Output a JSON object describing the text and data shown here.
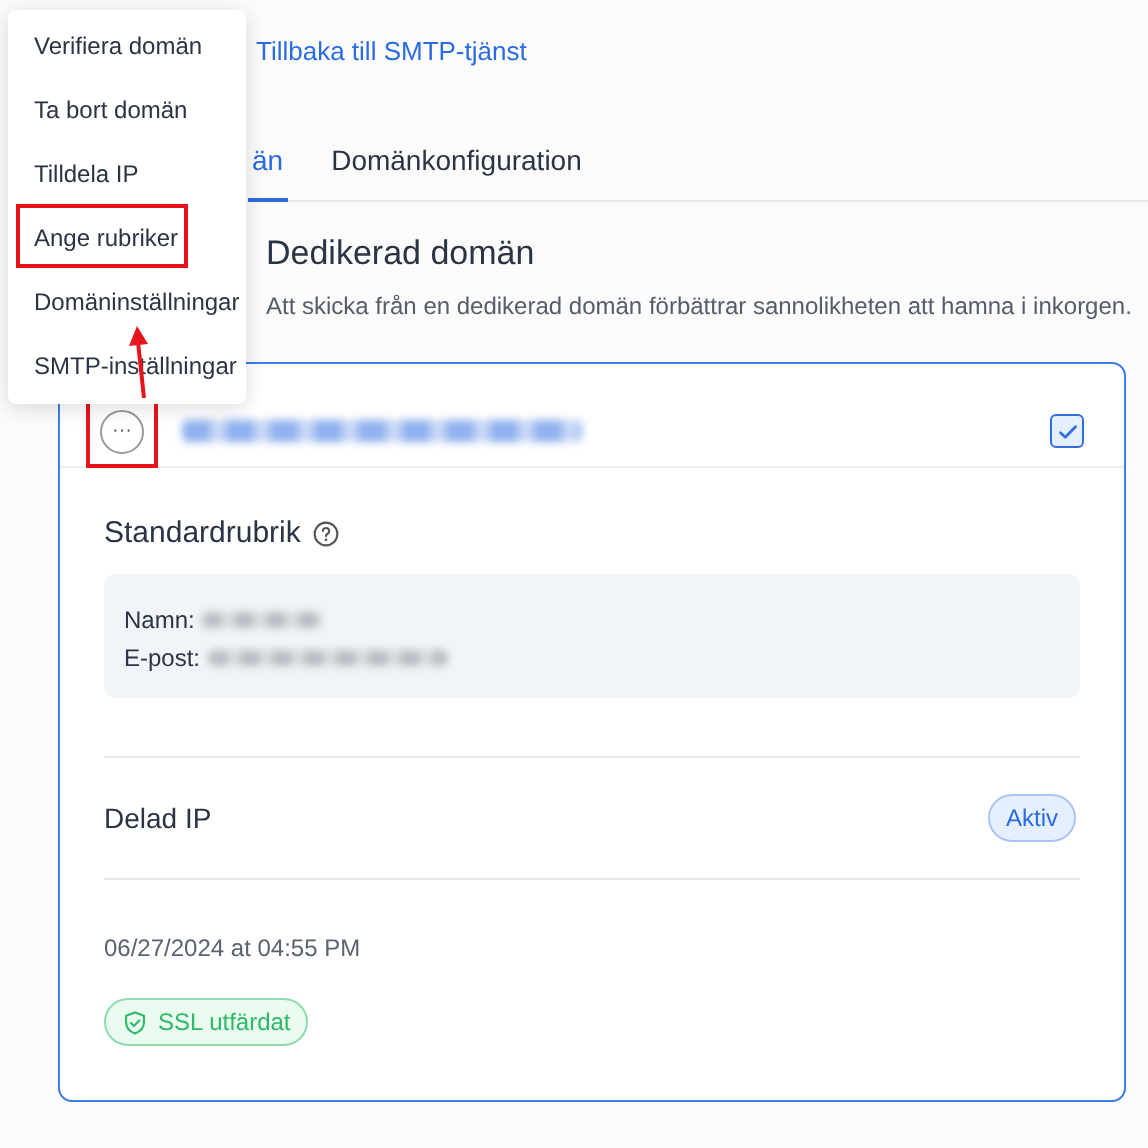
{
  "menu": {
    "items": [
      {
        "label": "Verifiera domän",
        "highlighted": false
      },
      {
        "label": "Ta bort domän",
        "highlighted": false
      },
      {
        "label": "Tilldela IP",
        "highlighted": false
      },
      {
        "label": "Ange rubriker",
        "highlighted": true
      },
      {
        "label": "Domäninställningar",
        "highlighted": false
      },
      {
        "label": "SMTP-inställningar",
        "highlighted": false
      }
    ]
  },
  "back_link": "Tillbaka till SMTP-tjänst",
  "tabs": [
    {
      "label": "än",
      "selected": true
    },
    {
      "label": "Domänkonfiguration",
      "selected": false
    }
  ],
  "section": {
    "title": "Dedikerad domän",
    "description": "Att skicka från en dedikerad domän förbättrar sannolikheten att hamna i inkorgen."
  },
  "domain_card": {
    "more_button": {
      "label": "···",
      "highlighted": true
    },
    "checked": true,
    "default_header": {
      "title": "Standardrubrik",
      "fields": [
        {
          "label": "Namn:"
        },
        {
          "label": "E-post:"
        }
      ]
    },
    "ip": {
      "label": "Delad IP",
      "status": "Aktiv"
    },
    "created": "06/27/2024 at 04:55 PM",
    "ssl_status": "SSL utfärdat"
  }
}
